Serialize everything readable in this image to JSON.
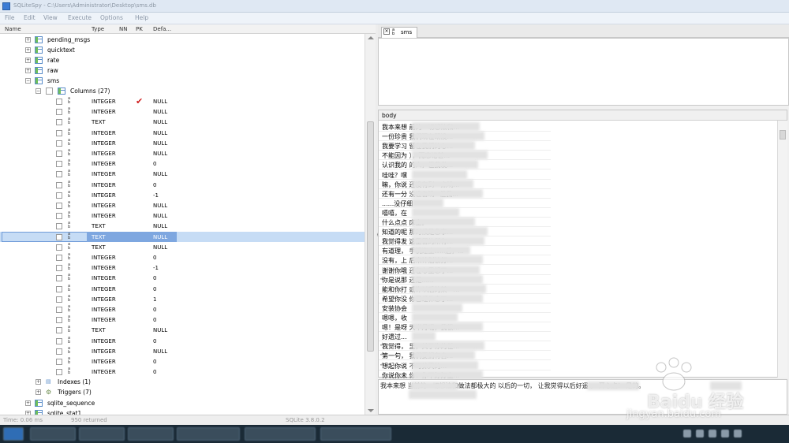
{
  "window": {
    "title": "SQLiteSpy - C:\\Users\\Administrator\\Desktop\\sms.db"
  },
  "menu": [
    "File",
    "Edit",
    "View",
    "Execute",
    "Options",
    "Help"
  ],
  "tree": {
    "headers": {
      "name": "Name",
      "type": "Type",
      "nn": "NN",
      "pk": "PK",
      "default": "Defa..."
    },
    "tables_top": [
      "pending_msgs",
      "quicktext",
      "rate",
      "raw",
      "sms"
    ],
    "columns_node": "Columns (27)",
    "columns": [
      {
        "type": "INTEGER",
        "pk": true,
        "default": "NULL"
      },
      {
        "type": "INTEGER",
        "default": "NULL"
      },
      {
        "type": "TEXT",
        "default": "NULL"
      },
      {
        "type": "INTEGER",
        "default": "NULL"
      },
      {
        "type": "INTEGER",
        "default": "NULL"
      },
      {
        "type": "INTEGER",
        "default": "NULL"
      },
      {
        "type": "INTEGER",
        "default": "0"
      },
      {
        "type": "INTEGER",
        "default": "NULL"
      },
      {
        "type": "INTEGER",
        "default": "0"
      },
      {
        "type": "INTEGER",
        "default": "-1"
      },
      {
        "type": "INTEGER",
        "default": "NULL"
      },
      {
        "type": "INTEGER",
        "default": "NULL"
      },
      {
        "type": "TEXT",
        "default": "NULL"
      },
      {
        "type": "TEXT",
        "default": "NULL",
        "selected": true
      },
      {
        "type": "TEXT",
        "default": "NULL"
      },
      {
        "type": "INTEGER",
        "default": "0"
      },
      {
        "type": "INTEGER",
        "default": "-1"
      },
      {
        "type": "INTEGER",
        "default": "0"
      },
      {
        "type": "INTEGER",
        "default": "0"
      },
      {
        "type": "INTEGER",
        "default": "1"
      },
      {
        "type": "INTEGER",
        "default": "0"
      },
      {
        "type": "INTEGER",
        "default": "0"
      },
      {
        "type": "TEXT",
        "default": "NULL"
      },
      {
        "type": "INTEGER",
        "default": "0"
      },
      {
        "type": "INTEGER",
        "default": "NULL"
      },
      {
        "type": "INTEGER",
        "default": "0"
      },
      {
        "type": "INTEGER",
        "default": "0"
      }
    ],
    "indexes_node": "Indexes (1)",
    "triggers_node": "Triggers (7)",
    "tables_bottom": [
      "sqlite_sequence",
      "sqlite_stat1"
    ]
  },
  "editor_tab": {
    "label": "sms"
  },
  "result": {
    "column_header": "body",
    "rows": [
      "我本来想                      前的一切想法和...",
      "一份珍贵                           我们现在既没...",
      "我要学习                         留在我们的心...",
      "不能因为                          ），而忘记甚...",
      "认识我的                          的人，但我发...",
      "哇哇？嘿",
      "嘛，你说                       还没有到一点哟...",
      "还有一分                          没准备哟~但我...",
      "......没仔细",
      "嘻嘻，在",
      "什么点点                       床上。",
      "知道的呢                          那时候是急事...",
      "我觉得发                          这里留的所有...",
      "有道理，                      手机连上wifi后，...",
      "没有，上                          后来计划被打...",
      "谢谢你哦                          还在心里想了...",
      "你是说那                          还是......",
      "能和你打                          或许以后的某一...",
      "希望你没                          你已经休息了...",
      "安装协会",
      "嗯嗯，收",
      "嗯！是呀                         天半月呢，我很...",
      "好遗过...",
      "我觉得，                          里，关于你的任...",
      "第一句，                          我们要拥有自...",
      "想起你说                          不可抹灭的...",
      "你说你未                          你！你不好好上..."
    ],
    "detail": "我本来想                        当前的一切想法和做法都极大的             以后的一切，          让我觉得以后好遥             。              开心点！ 是的。"
  },
  "status": {
    "time": "Time: 0.06 ms",
    "rows": "950 returned",
    "version": "SQLite 3.8.0.2"
  },
  "watermark": {
    "brand": "Baidu 经验",
    "url": "jingyan.baidu.com"
  }
}
